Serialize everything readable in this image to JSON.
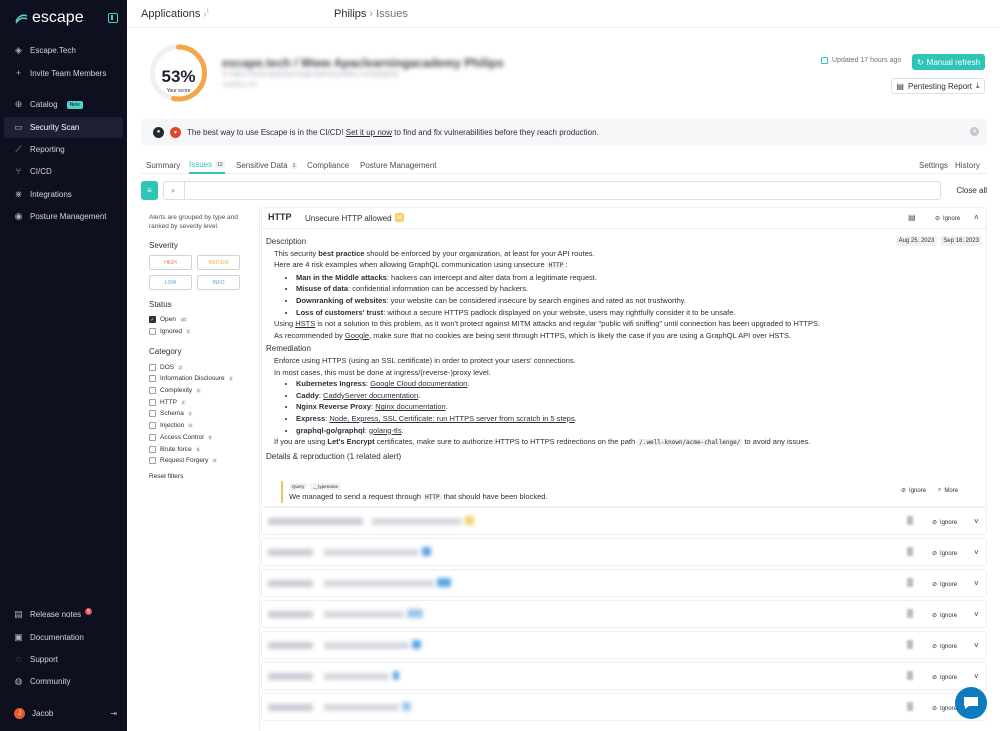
{
  "sidebar": {
    "logo": "escape",
    "items": [
      {
        "label": "Escape.Tech",
        "icon": "layers-icon"
      },
      {
        "label": "Invite Team Members",
        "icon": "plus-icon"
      },
      {
        "label": "Catalog",
        "icon": "globe-icon",
        "badge": "New"
      },
      {
        "label": "Security Scan",
        "icon": "scan-icon"
      },
      {
        "label": "Reporting",
        "icon": "chart-icon"
      },
      {
        "label": "CI/CD",
        "icon": "branch-icon"
      },
      {
        "label": "Integrations",
        "icon": "integrations-icon"
      },
      {
        "label": "Posture Management",
        "icon": "eye-icon"
      }
    ],
    "bottom": [
      {
        "label": "Release notes",
        "icon": "release-icon",
        "badge": "5"
      },
      {
        "label": "Documentation",
        "icon": "book-icon"
      },
      {
        "label": "Support",
        "icon": "support-icon"
      },
      {
        "label": "Community",
        "icon": "discord-icon"
      }
    ],
    "user": {
      "initial": "J",
      "name": "Jacob"
    }
  },
  "breadcrumb": {
    "root": "Applications",
    "sup": "1",
    "project": "Philips",
    "page": "Issues"
  },
  "score": {
    "value": "53%",
    "label": "Your score",
    "fraction": 0.53
  },
  "project": {
    "title": "escape.tech / Www Apaclearningacademy Philips",
    "url": "https://www.apaclearningacademy.philips.com/graphql",
    "sub": "GraphQL API"
  },
  "header": {
    "updated": "Updated 17 hours ago",
    "refresh": "Manual refresh",
    "report": "Pentesting Report"
  },
  "banner": {
    "pre": "The best way to use Escape is in the CI/CD!",
    "link": "Set it up now",
    "post": "to find and fix vulnerabilities before they reach production."
  },
  "tabs": [
    {
      "label": "Summary",
      "count": ""
    },
    {
      "label": "Issues",
      "count": "12"
    },
    {
      "label": "Sensitive Data",
      "count": "1"
    },
    {
      "label": "Compliance",
      "count": ""
    },
    {
      "label": "Posture Management",
      "count": ""
    }
  ],
  "tabs_right": {
    "settings": "Settings",
    "history": "History"
  },
  "search": {
    "placeholder": "",
    "close_all": "Close all"
  },
  "filters": {
    "note": "Alerts are grouped by type and ranked by severity level.",
    "severity_title": "Severity",
    "severities": [
      {
        "label": "HIGH",
        "color": "#e8705a"
      },
      {
        "label": "MEDIUM",
        "color": "#e8b34a"
      },
      {
        "label": "LOW",
        "color": "#4fa3e0"
      },
      {
        "label": "INFO",
        "color": "#4fa3e0"
      }
    ],
    "status_title": "Status",
    "statuses": [
      {
        "label": "Open",
        "count": "10",
        "checked": true
      },
      {
        "label": "Ignored",
        "count": "2",
        "checked": false
      }
    ],
    "category_title": "Category",
    "categories": [
      {
        "label": "DOS",
        "count": "2"
      },
      {
        "label": "Information Disclosure",
        "count": "2"
      },
      {
        "label": "Complexity",
        "count": "3"
      },
      {
        "label": "HTTP",
        "count": "2"
      },
      {
        "label": "Schema",
        "count": "1"
      },
      {
        "label": "Injection",
        "count": "0"
      },
      {
        "label": "Access Control",
        "count": "0"
      },
      {
        "label": "Brute force",
        "count": "0"
      },
      {
        "label": "Request Forgery",
        "count": "0"
      }
    ],
    "reset": "Reset filters"
  },
  "issue": {
    "tag": "HTTP",
    "title": "Unsecure HTTP allowed",
    "severity": "M",
    "ignore": "Ignore",
    "dates": [
      "Aug 25, 2023",
      "Sep 18, 2023"
    ],
    "desc_title": "Description",
    "d1a": "This security ",
    "d1b": "best practice",
    "d1c": " should be enforced by your organization, at least for your API routes.",
    "d2a": "Here are 4 risk examples when allowing GraphQL communication using unsecure ",
    "d2code": "HTTP",
    "d2b": ":",
    "risks": [
      {
        "b": "Man in the Middle attacks",
        "t": ": hackers can intercept and alter data from a legitimate request."
      },
      {
        "b": "Misuse of data",
        "t": ": confidential information can be accessed by hackers."
      },
      {
        "b": "Downranking of websites",
        "t": ": your website can be considered insecure by search engines and rated as not trustworthy."
      },
      {
        "b": "Loss of customers' trust",
        "t": ": without a secure HTTPS padlock displayed on your website, users may rightfully consider it to be unsafe."
      }
    ],
    "d3a": "Using ",
    "d3link": "HSTS",
    "d3b": " is not a solution to this problem, as it won't protect against MITM attacks and regular \"public wifi sniffing\" until connection has been upgraded to HTTPS.",
    "d4a": "As recommended by ",
    "d4link": "Google",
    "d4b": ", make sure that no cookies are being sent through HTTPS, which is likely the case if you are using a GraphQL API over HSTS.",
    "rem_title": "Remediation",
    "r1": "Enforce using HTTPS (using an SSL certificate) in order to protect your users' connections.",
    "r2": "In most cases, this must be done at ingress/(reverse-)proxy level.",
    "fixes": [
      {
        "b": "Kubernetes Ingress",
        "l": "Google Cloud documentation"
      },
      {
        "b": "Caddy",
        "l": "CaddyServer documentation"
      },
      {
        "b": "Nginx Reverse Proxy",
        "l": "Nginx documentation"
      },
      {
        "b": "Express",
        "l": "Node, Express, SSL Certificate: run HTTPS server from scratch in 5 steps"
      },
      {
        "b": "graphql-go/graphql",
        "l": "golang-tls"
      }
    ],
    "r3a": "If you are using ",
    "r3b": "Let's Encrypt",
    "r3c": " certificates, make sure to authorize HTTPS to HTTPS redirections on the path ",
    "r3code": "/.well-known/acme-challenge/",
    "r3d": " to avoid any issues.",
    "details_title": "Details & reproduction (1 related alert)",
    "q1": "Query",
    "q2": "__typename",
    "repro_a": "We managed to send a request through ",
    "repro_code": "HTTP",
    "repro_b": " that should have been blocked.",
    "more": "More"
  },
  "rows_ignore": "Ignore",
  "colors": {
    "accent": "#2ec5b6",
    "sidebar": "#0e0f1f",
    "score": "#f5a64a"
  }
}
